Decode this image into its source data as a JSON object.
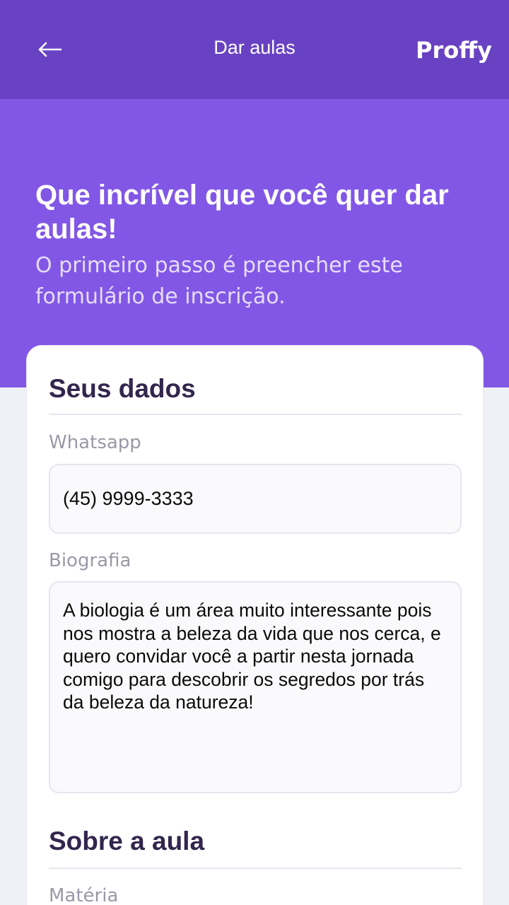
{
  "header": {
    "title": "Dar aulas",
    "logo_text": "Proffy",
    "back_icon": "arrow-left-icon"
  },
  "hero": {
    "title": "Que incrível que você quer dar aulas!",
    "subtitle": "O primeiro passo é preencher este formulário de inscrição."
  },
  "form": {
    "section_personal": "Seus dados",
    "whatsapp_label": "Whatsapp",
    "whatsapp_value": "(45) 9999-3333",
    "bio_label": "Biografia",
    "bio_value": "A biologia é um área muito interessante pois nos mostra a beleza da vida que nos cerca, e quero convidar você a partir nesta jornada comigo para descobrir os segredos por trás da beleza da natureza!",
    "section_class": "Sobre a aula",
    "subject_label": "Matéria"
  },
  "colors": {
    "header_bg": "#6842C2",
    "hero_bg": "#8257E5",
    "page_bg": "#F0F0F7",
    "title_dark": "#32264D",
    "label_gray": "#9C98A6"
  }
}
